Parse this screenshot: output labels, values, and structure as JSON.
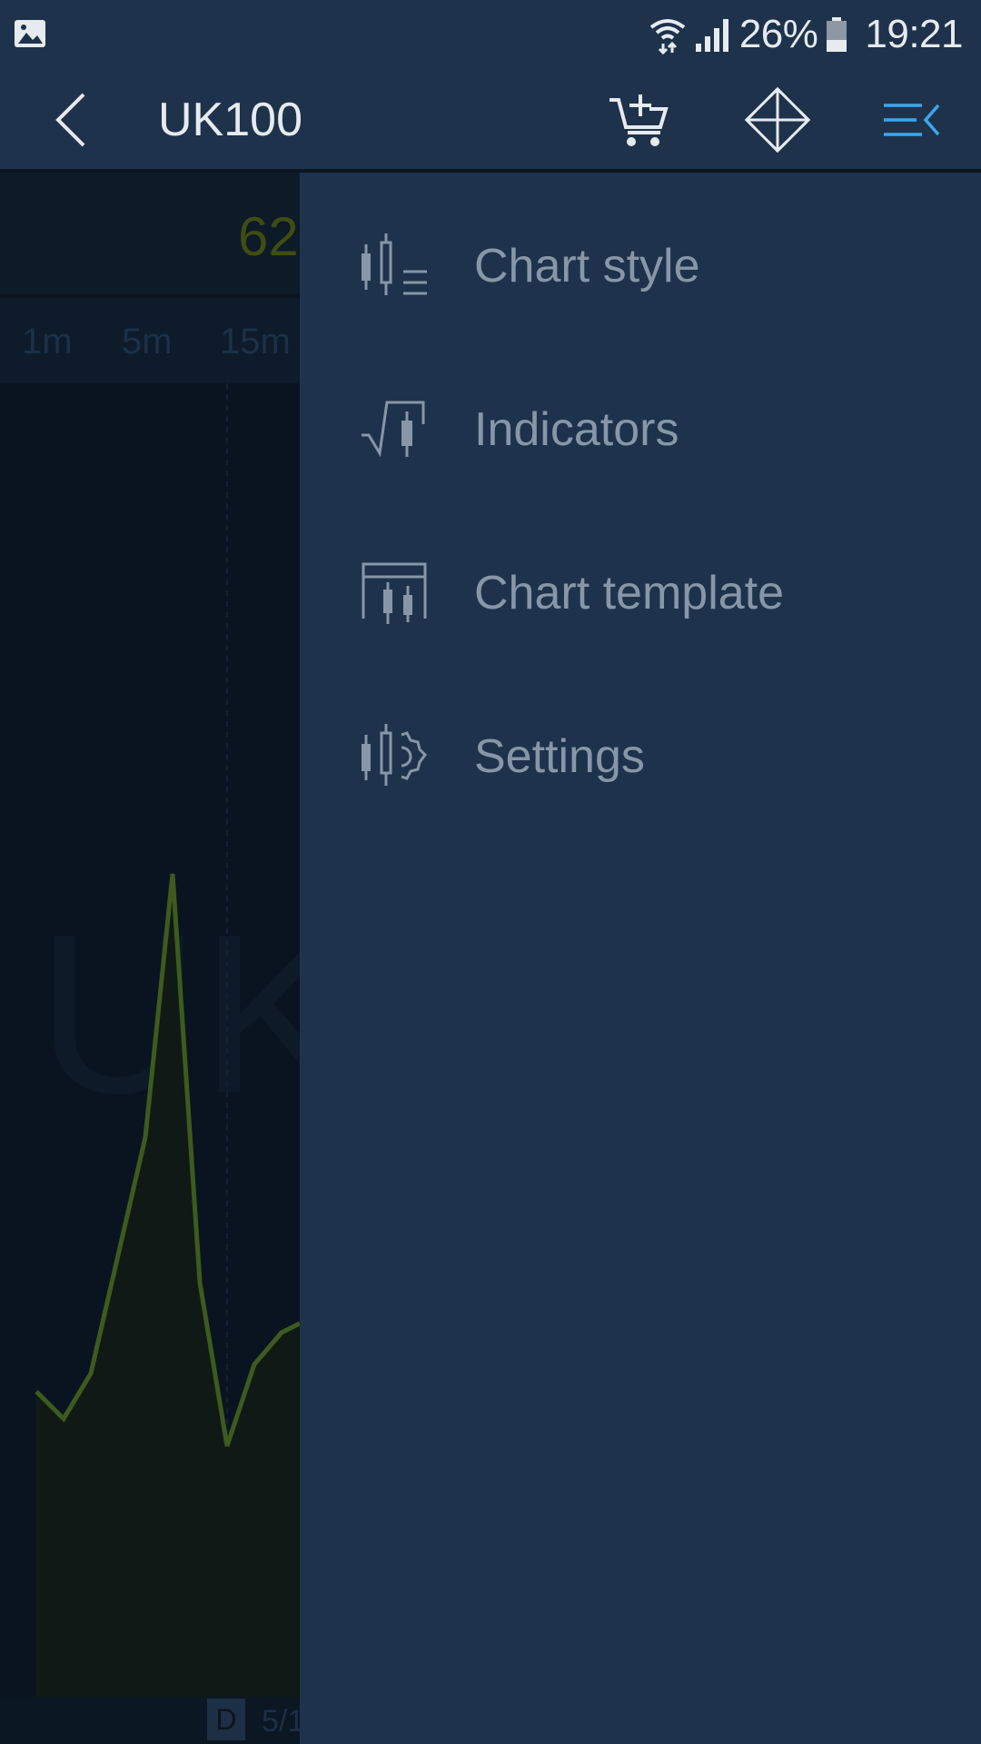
{
  "status_bar": {
    "battery": "26%",
    "time": "19:21"
  },
  "toolbar": {
    "title": "UK100",
    "back_icon": "chevron-left-icon",
    "icons": [
      "cart-add-icon",
      "move-arrows-icon",
      "menu-collapse-icon"
    ],
    "accent_color": "#3ba8f0"
  },
  "background_chart": {
    "price_fragment": "62",
    "timeframes": [
      "1m",
      "5m",
      "15m"
    ],
    "watermark": "UK",
    "period_badge": "D",
    "date_fragment": "5/1",
    "line_color": "#3f5a1e"
  },
  "drawer": {
    "items": [
      {
        "label": "Chart style",
        "icon": "chart-style-icon"
      },
      {
        "label": "Indicators",
        "icon": "indicators-icon"
      },
      {
        "label": "Chart template",
        "icon": "chart-template-icon"
      },
      {
        "label": "Settings",
        "icon": "chart-settings-icon"
      }
    ]
  }
}
